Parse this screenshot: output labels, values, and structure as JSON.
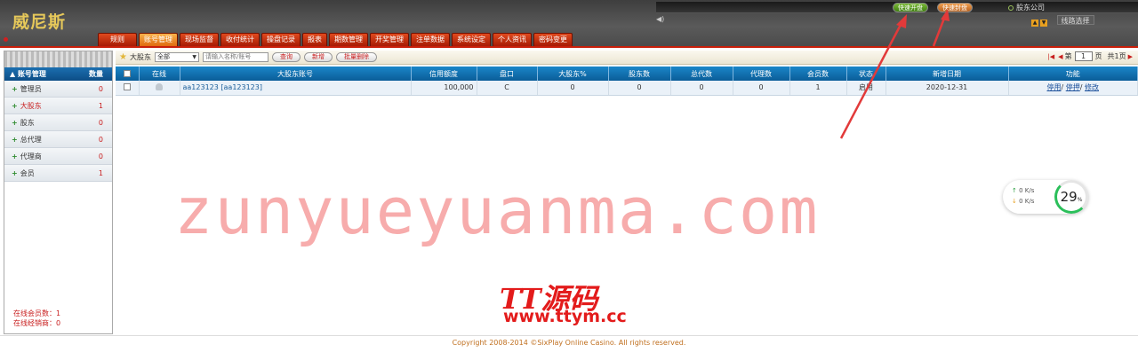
{
  "header": {
    "logo": "威尼斯",
    "quick_open_label": "快速开盘",
    "quick_close_label": "快速封盘",
    "company": "股东公司",
    "line_select_label": "线路选择"
  },
  "nav": {
    "tabs": [
      "规则",
      "账号管理",
      "现场监督",
      "收付统计",
      "操盘记录",
      "报表",
      "期数管理",
      "开奖管理",
      "注单数据",
      "系统设定",
      "个人资讯",
      "密码变更"
    ]
  },
  "sidebar": {
    "title": "账号管理",
    "count_label": "数量",
    "items": [
      {
        "label": "管理员",
        "count": "0"
      },
      {
        "label": "大股东",
        "count": "1"
      },
      {
        "label": "股东",
        "count": "0"
      },
      {
        "label": "总代理",
        "count": "0"
      },
      {
        "label": "代理商",
        "count": "0"
      },
      {
        "label": "会员",
        "count": "1"
      }
    ],
    "online_members": "在线会员数：1",
    "online_agents": "在线经销商：0"
  },
  "toolbar": {
    "label": "大股东",
    "select_value": "全部",
    "search_placeholder": "请输入名称/账号",
    "query_label": "查询",
    "add_label": "新增",
    "bulk_delete_label": "批量删除",
    "pager": {
      "page_prefix": "第",
      "page_value": "1",
      "page_suffix": "页",
      "total": "共1页"
    }
  },
  "table": {
    "headers": [
      "",
      "在线",
      "大股东账号",
      "信用额度",
      "盘口",
      "大股东%",
      "股东数",
      "总代数",
      "代理数",
      "会员数",
      "状态",
      "新增日期",
      "功能"
    ],
    "rows": [
      {
        "account": "aa123123 [aa123123]",
        "credit": "100,000",
        "plate": "C",
        "percent": "0",
        "shareholders": "0",
        "general_agents": "0",
        "agents": "0",
        "members": "1",
        "status": "启用",
        "date": "2020-12-31",
        "actions": [
          "停用",
          "停押",
          "修改"
        ]
      }
    ]
  },
  "overlay": {
    "watermark": "zunyueyuanma.com",
    "brand": "TT源码",
    "brand_url": "www.ttym.cc",
    "upload_speed": "0 K/s",
    "download_speed": "0 K/s",
    "percent": "29",
    "percent_unit": "%"
  },
  "footer": {
    "copyright": "Copyright 2008-2014 ©SixPlay Online Casino. All rights reserved."
  },
  "colors": {
    "accent_red": "#c81e0a",
    "header_blue": "#0b5d98",
    "annotation_red": "#e23a3a"
  }
}
